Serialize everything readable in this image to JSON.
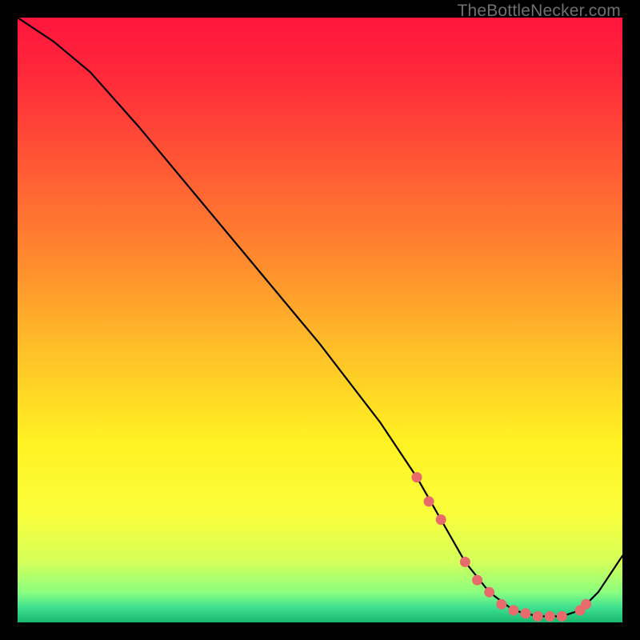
{
  "watermark": "TheBottleNecker.com",
  "gradient_stops": [
    {
      "offset": 0.0,
      "color": "#ff153c"
    },
    {
      "offset": 0.1,
      "color": "#ff2a3a"
    },
    {
      "offset": 0.25,
      "color": "#ff5a34"
    },
    {
      "offset": 0.4,
      "color": "#ff8a2e"
    },
    {
      "offset": 0.55,
      "color": "#ffc028"
    },
    {
      "offset": 0.7,
      "color": "#fff122"
    },
    {
      "offset": 0.82,
      "color": "#faff3a"
    },
    {
      "offset": 0.9,
      "color": "#d4ff5a"
    },
    {
      "offset": 0.95,
      "color": "#8cff80"
    },
    {
      "offset": 0.975,
      "color": "#40e090"
    },
    {
      "offset": 1.0,
      "color": "#18b870"
    }
  ],
  "curve_color": "#000000",
  "marker_color": "#e86a6a",
  "chart_data": {
    "type": "line",
    "title": "",
    "xlabel": "",
    "ylabel": "",
    "xlim": [
      0,
      100
    ],
    "ylim": [
      0,
      100
    ],
    "series": [
      {
        "name": "bottleneck-curve",
        "x": [
          0,
          6,
          12,
          20,
          30,
          40,
          50,
          60,
          66,
          70,
          74,
          78,
          82,
          86,
          90,
          93,
          96,
          100
        ],
        "y": [
          100,
          96,
          91,
          82,
          70,
          58,
          46,
          33,
          24,
          17,
          10,
          5,
          2,
          1,
          1,
          2,
          5,
          11
        ]
      }
    ],
    "markers": {
      "name": "highlighted-points",
      "x": [
        66,
        68,
        70,
        74,
        76,
        78,
        80,
        82,
        84,
        86,
        88,
        90,
        93,
        94
      ],
      "y": [
        24,
        20,
        17,
        10,
        7,
        5,
        3,
        2,
        1.5,
        1,
        1,
        1,
        2,
        3
      ]
    }
  }
}
